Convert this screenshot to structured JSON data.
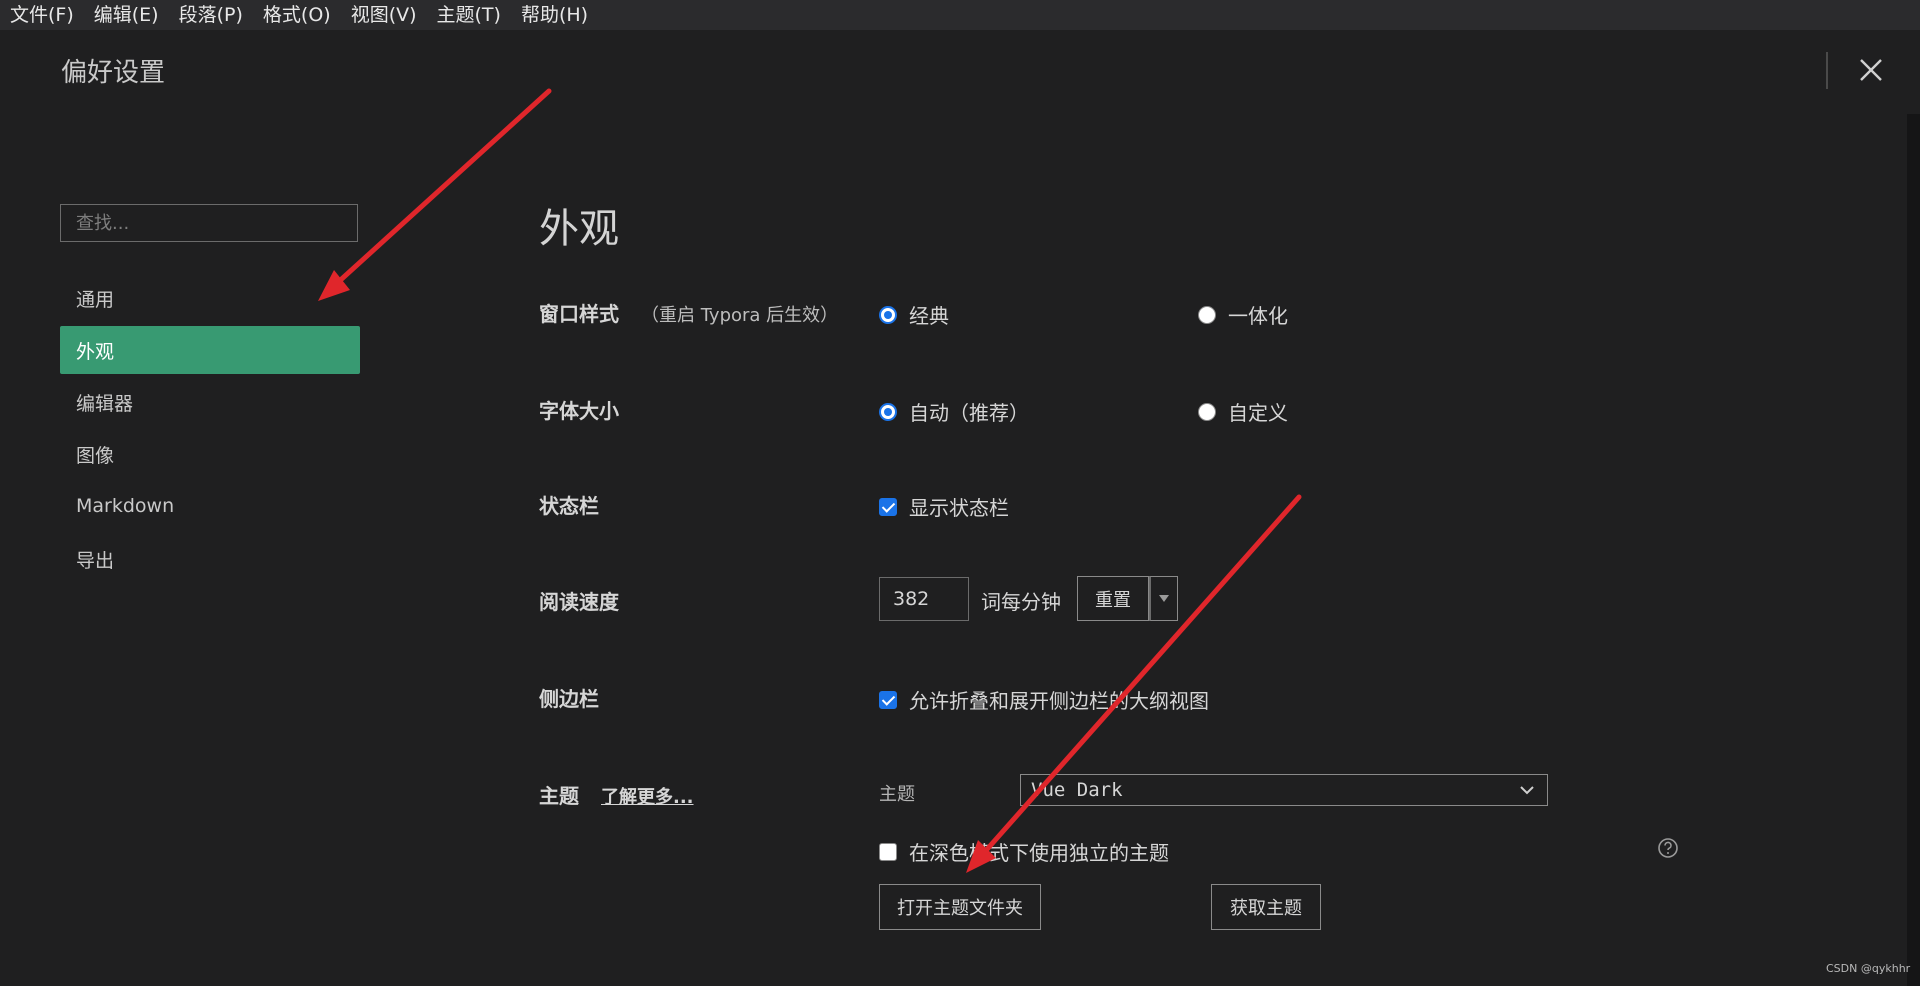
{
  "menubar": {
    "items": [
      "文件(F)",
      "编辑(E)",
      "段落(P)",
      "格式(O)",
      "视图(V)",
      "主题(T)",
      "帮助(H)"
    ]
  },
  "dialog": {
    "title": "偏好设置"
  },
  "sidebar": {
    "search_placeholder": "查找...",
    "items": [
      "通用",
      "外观",
      "编辑器",
      "图像",
      "Markdown",
      "导出"
    ],
    "active_index": 1
  },
  "content": {
    "section_title": "外观",
    "window_style": {
      "label": "窗口样式",
      "note": "（重启 Typora 后生效）",
      "options": [
        "经典",
        "一体化"
      ],
      "selected": "经典"
    },
    "font_size": {
      "label": "字体大小",
      "options": [
        "自动（推荐）",
        "自定义"
      ],
      "selected": "自动（推荐）"
    },
    "status_bar": {
      "label": "状态栏",
      "checkbox_label": "显示状态栏",
      "checked": true
    },
    "reading_speed": {
      "label": "阅读速度",
      "value": "382",
      "unit": "词每分钟",
      "reset_label": "重置"
    },
    "sidebar_opt": {
      "label": "侧边栏",
      "checkbox_label": "允许折叠和展开侧边栏的大纲视图",
      "checked": true
    },
    "theme": {
      "label": "主题",
      "learn_more": "了解更多...",
      "sub_label": "主题",
      "selected_theme": "Vue Dark",
      "dark_mode_label": "在深色模式下使用独立的主题",
      "dark_mode_checked": false,
      "open_folder_label": "打开主题文件夹",
      "get_themes_label": "获取主题"
    }
  },
  "watermark": "CSDN @qykhhr",
  "colors": {
    "background": "#1f1f20",
    "active_item": "#389a72",
    "accent_blue": "#1a73e8",
    "annotation_arrow": "#e0262b"
  }
}
